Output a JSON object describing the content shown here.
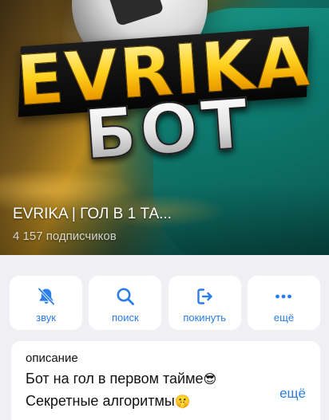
{
  "cover": {
    "logo_top": "EVRIKA",
    "logo_bottom": "БОТ",
    "title": "EVRIKA | ГОЛ В 1 ТА...",
    "subscribers": "4 157 подписчиков"
  },
  "actions": [
    {
      "label": "звук",
      "icon": "muted-bell-icon"
    },
    {
      "label": "поиск",
      "icon": "search-icon"
    },
    {
      "label": "покинуть",
      "icon": "leave-icon"
    },
    {
      "label": "ещё",
      "icon": "more-dots-icon"
    }
  ],
  "description": {
    "caption": "описание",
    "line1": "Бот на гол в первом тайме",
    "line1_emoji": "😎",
    "line2": "Секретные алгоритмы",
    "line2_emoji": "🤫",
    "more_label": "ещё"
  },
  "colors": {
    "accent": "#2a7ee6",
    "background": "#efeff4",
    "card": "#ffffff"
  }
}
